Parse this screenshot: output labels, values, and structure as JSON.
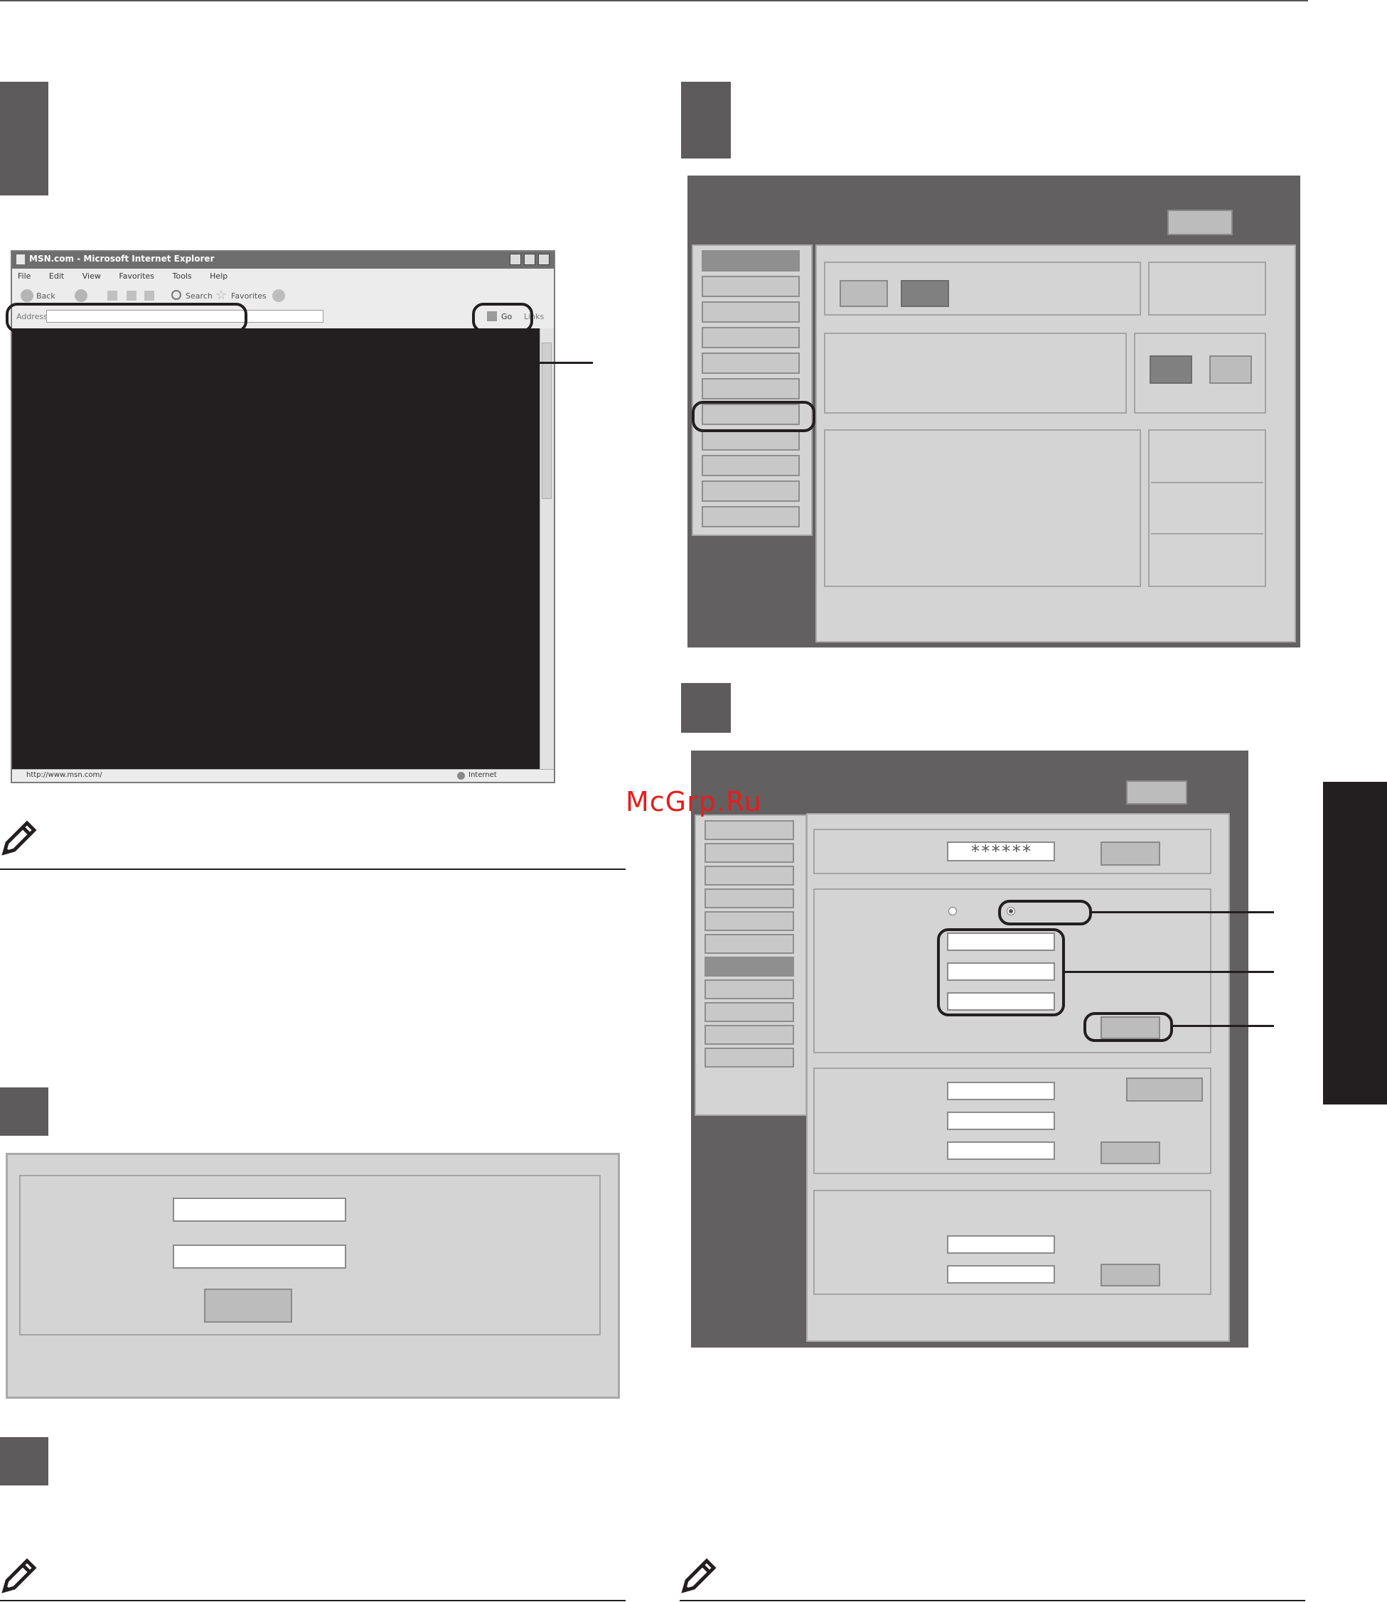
{
  "watermark": "McGrp.Ru",
  "browser": {
    "title": "MSN.com - Microsoft Internet Explorer",
    "menu": [
      "File",
      "Edit",
      "View",
      "Favorites",
      "Tools",
      "Help"
    ],
    "toolbar": {
      "back": "Back",
      "search": "Search",
      "favorites": "Favorites"
    },
    "address_label": "Address",
    "go_label": "Go",
    "links_label": "Links",
    "status_url": "http://www.msn.com/",
    "status_zone": "Internet"
  },
  "settings_form": {
    "password_mask": "******"
  },
  "colors": {
    "step_box": "#5e5b5c",
    "panel_dark": "#636061",
    "panel_light": "#d4d4d4",
    "ie_titlebar": "#6e6e6e",
    "ie_content": "#231f20",
    "side_tab": "#231f20",
    "watermark": "#e51d1d"
  },
  "icons": [
    "pencil-icon",
    "ie-logo-icon",
    "radio-icon",
    "go-arrow-icon",
    "globe-icon"
  ]
}
